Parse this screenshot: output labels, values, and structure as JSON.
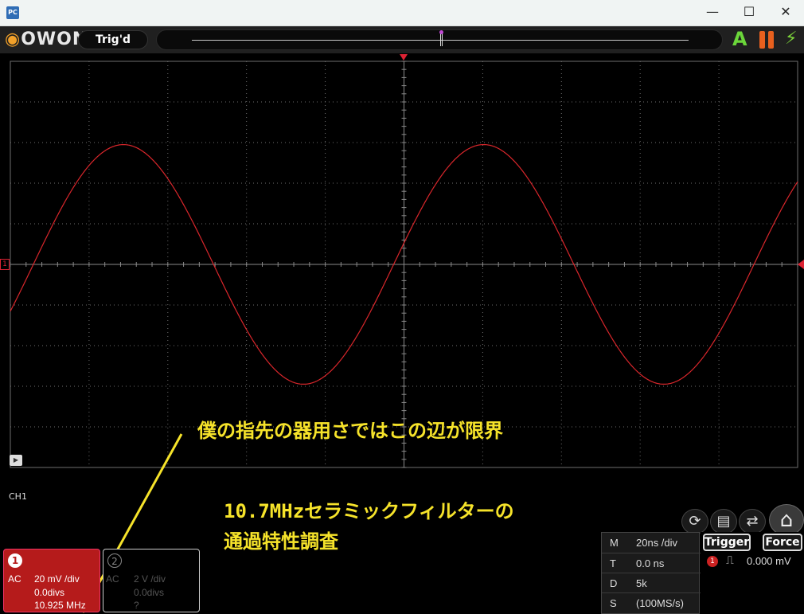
{
  "window": {
    "app_icon": "PC",
    "minimize": "—",
    "maximize": "☐",
    "close": "✕"
  },
  "toolbar": {
    "logo": "OWON",
    "trig_status": "Trig'd",
    "auto_icon": "A",
    "pause_icon": "pause-icon",
    "bolt_icon": "⚡"
  },
  "screen": {
    "ch1_marker": "1",
    "ch1_label": "CH1",
    "annotation": "僕の指先の器用さではこの辺が限界",
    "caption_line1": "10.7MHzセラミックフィルターの",
    "caption_line2": "通過特性調査"
  },
  "channels": [
    {
      "badge": "1",
      "coupling": "AC",
      "scale": "20 mV /div",
      "offset": "0.0divs",
      "freq": "10.925 MHz",
      "active": true
    },
    {
      "badge": "2",
      "coupling": "AC",
      "scale": "2 V /div",
      "offset": "0.0divs",
      "freq": "?",
      "active": false
    }
  ],
  "timebase": {
    "rows": [
      {
        "key": "M",
        "value": "20ns /div"
      },
      {
        "key": "T",
        "value": "0.0 ns"
      },
      {
        "key": "D",
        "value": "5k"
      },
      {
        "key": "S",
        "value": "(100MS/s)"
      }
    ]
  },
  "trigger": {
    "trigger_label": "Trigger",
    "force_label": "Force",
    "channel": "1",
    "edge": "rising",
    "level": "0.000 mV"
  },
  "colors": {
    "trace": "#d9262b",
    "grid": "#6e6e6e",
    "annotation": "#f6e32a",
    "ch1": "#b51b1b"
  },
  "chart_data": {
    "type": "line",
    "title": "",
    "xlabel": "",
    "ylabel": "",
    "series": [
      {
        "shape": "sine",
        "frequency_mhz": 10.925,
        "amplitude_divs": 2.95,
        "offset_divs": 0.0
      }
    ],
    "x_divs": 10,
    "y_divs": 10,
    "grid": true,
    "annotation_pointer": {
      "from": "annotation",
      "to": "ch1-frequency"
    }
  }
}
